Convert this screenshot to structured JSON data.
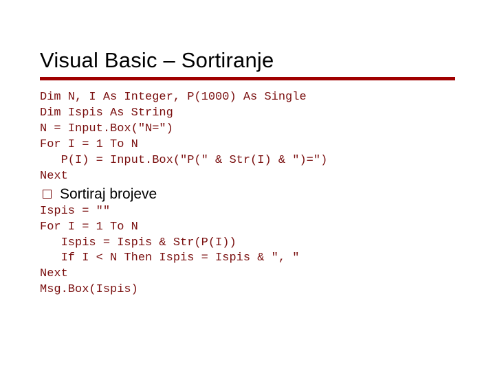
{
  "title": "Visual Basic – Sortiranje",
  "code1": "Dim N, I As Integer, P(1000) As Single\nDim Ispis As String\nN = Input.Box(\"N=\")\nFor I = 1 To N\n   P(I) = Input.Box(\"P(\" & Str(I) & \")=\")\nNext",
  "bullet": "Sortiraj brojeve",
  "code2": "Ispis = \"\"\nFor I = 1 To N\n   Ispis = Ispis & Str(P(I))\n   If I < N Then Ispis = Ispis & \", \"\nNext\nMsg.Box(Ispis)"
}
